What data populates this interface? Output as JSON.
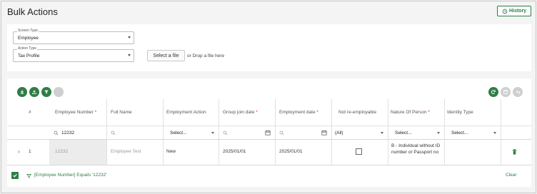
{
  "page": {
    "title": "Bulk Actions"
  },
  "header": {
    "history_label": "History",
    "history_icon": "history-icon"
  },
  "form": {
    "screen_type": {
      "label": "Screen Type",
      "value": "Employee"
    },
    "action_type": {
      "label": "Action Type",
      "value": "Tax Profile"
    },
    "select_file_label": "Select a file",
    "drop_text": "or Drop a file here"
  },
  "toolbar": {
    "left_icons": [
      "download-icon",
      "download-alt-icon",
      "filter-icon",
      "disabled-icon"
    ],
    "right_icons": [
      "refresh-icon",
      "save-icon",
      "undo-icon"
    ]
  },
  "grid": {
    "columns": [
      {
        "label": "#",
        "required": false
      },
      {
        "label": "Employee Number",
        "required": true
      },
      {
        "label": "Full Name",
        "required": false
      },
      {
        "label": "Employment Action",
        "required": false
      },
      {
        "label": "Group join date",
        "required": true
      },
      {
        "label": "Employment date",
        "required": true
      },
      {
        "label": "Not re-employable",
        "required": false
      },
      {
        "label": "Nature Of Person",
        "required": true
      },
      {
        "label": "Identity Type",
        "required": false
      }
    ],
    "filters": {
      "employee_number": "12232",
      "employment_action": "Select...",
      "not_reemployable": "(All)",
      "nature_of_person": "Select...",
      "identity_type": "Select..."
    },
    "rows": [
      {
        "index": "1",
        "employee_number": "12232",
        "full_name": "Employee Test",
        "employment_action": "New",
        "group_join_date": "2025/01/01",
        "employment_date": "2025/01/01",
        "not_reemployable": false,
        "nature_of_person": "B - Individual without ID number or Passport no",
        "identity_type": ""
      }
    ]
  },
  "footer": {
    "filter_expression": "[Employee Number] Equals '12232'",
    "clear_label": "Clear"
  },
  "colors": {
    "accent": "#2e7d46",
    "required": "#d32f2f"
  }
}
